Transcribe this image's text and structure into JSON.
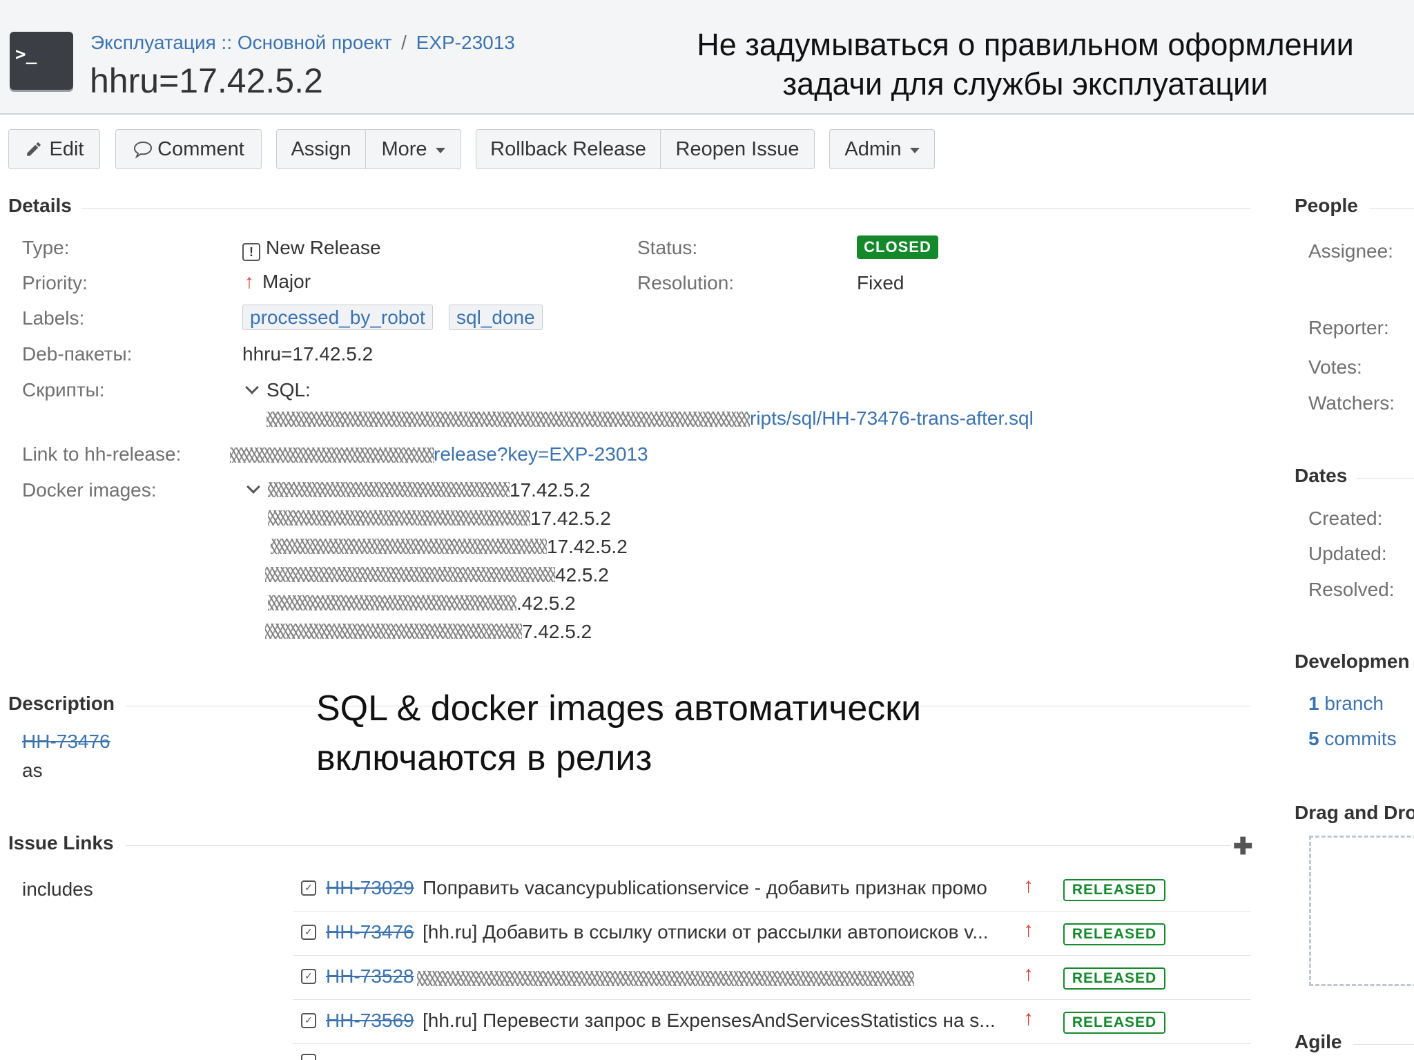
{
  "header": {
    "breadcrumb_project": "Эксплуатация :: Основной проект",
    "breadcrumb_sep": "/",
    "breadcrumb_issue": "EXP-23013",
    "title": "hhru=17.42.5.2",
    "project_icon_text": ">_"
  },
  "annotations": {
    "top_line1": "Не задумываться о правильном оформлении",
    "top_line2": "задачи для службы эксплуатации",
    "mid_line1": "SQL & docker images автоматически",
    "mid_line2": "включаются в релиз"
  },
  "toolbar": {
    "edit": "Edit",
    "comment": "Comment",
    "assign": "Assign",
    "more": "More",
    "rollback": "Rollback Release",
    "reopen": "Reopen Issue",
    "admin": "Admin"
  },
  "details": {
    "heading": "Details",
    "type_label": "Type:",
    "type_value": "New Release",
    "priority_label": "Priority:",
    "priority_value": "Major",
    "labels_label": "Labels:",
    "labels": [
      "processed_by_robot",
      "sql_done"
    ],
    "deb_label": "Deb-пакеты:",
    "deb_value": "hhru=17.42.5.2",
    "scripts_label": "Скрипты:",
    "scripts_sql": "SQL:",
    "scripts_file": "ripts/sql/HH-73476-trans-after.sql",
    "release_link_label": "Link to hh-release:",
    "release_link": "release?key=EXP-23013",
    "docker_label": "Docker images:",
    "docker_images": [
      "17.42.5.2",
      "17.42.5.2",
      "17.42.5.2",
      "42.5.2",
      ".42.5.2",
      "7.42.5.2"
    ],
    "status_label": "Status:",
    "status_value": "CLOSED",
    "resolution_label": "Resolution:",
    "resolution_value": "Fixed"
  },
  "description": {
    "heading": "Description",
    "issue_key": "HH-73476",
    "text": "as"
  },
  "issue_links": {
    "heading": "Issue Links",
    "add_icon": "plus-icon",
    "relation": "includes",
    "rows": [
      {
        "key": "HH-73029",
        "summary": "Поправить vacancypublicationservice - добавить признак промо",
        "status": "RELEASED"
      },
      {
        "key": "HH-73476",
        "summary": "[hh.ru] Добавить в ссылку отписки от рассылки автопоисков v...",
        "status": "RELEASED"
      },
      {
        "key": "HH-73528",
        "summary": "",
        "status": "RELEASED"
      },
      {
        "key": "HH-73569",
        "summary": "[hh.ru] Перевести запрос в ExpensesAndServicesStatistics на s...",
        "status": "RELEASED"
      }
    ]
  },
  "sidebar": {
    "people_heading": "People",
    "assignee_label": "Assignee:",
    "reporter_label": "Reporter:",
    "votes_label": "Votes:",
    "watchers_label": "Watchers:",
    "dates_heading": "Dates",
    "created_label": "Created:",
    "updated_label": "Updated:",
    "resolved_label": "Resolved:",
    "development_heading": "Developmen",
    "branch_count": "1",
    "branch_label": "branch",
    "commits_count": "5",
    "commits_label": "commits",
    "drag_heading": "Drag and Dro",
    "agile_heading": "Agile"
  },
  "colors": {
    "link": "#3b73af",
    "status_closed": "#14892c",
    "released": "#14892c",
    "priority_major": "#d04437"
  }
}
